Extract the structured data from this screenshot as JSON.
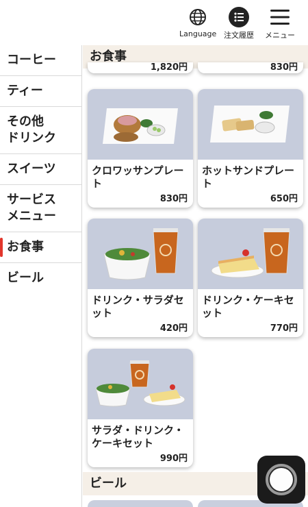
{
  "header": {
    "language_label": "Language",
    "history_label": "注文履歴",
    "menu_label": "メニュー"
  },
  "sidebar": {
    "items": [
      {
        "label": "コーヒー"
      },
      {
        "label": "ティー"
      },
      {
        "label": "その他\nドリンク"
      },
      {
        "label": "スイーツ"
      },
      {
        "label": "サービス\nメニュー"
      },
      {
        "label": "お食事"
      },
      {
        "label": "ビール"
      }
    ],
    "active_index": 5
  },
  "content": {
    "section_title": "お食事",
    "prev_prices": [
      "1,820円",
      "830円"
    ],
    "items": [
      {
        "name": "クロワッサンプレート",
        "price": "830円",
        "image": "croissant-plate-photo"
      },
      {
        "name": "ホットサンドプレート",
        "price": "650円",
        "image": "hot-sand-plate-photo"
      },
      {
        "name": "ドリンク・サラダセット",
        "price": "420円",
        "image": "drink-salad-set-photo"
      },
      {
        "name": "ドリンク・ケーキセット",
        "price": "770円",
        "image": "drink-cake-set-photo"
      },
      {
        "name": "サラダ・ドリンク・ケーキセット",
        "price": "990円",
        "image": "salad-drink-cake-set-photo"
      }
    ],
    "next_section_title": "ビール"
  },
  "colors": {
    "accent": "#e2362c",
    "section_bg": "#f5efe7",
    "photo_bg": "#c9cfde"
  }
}
